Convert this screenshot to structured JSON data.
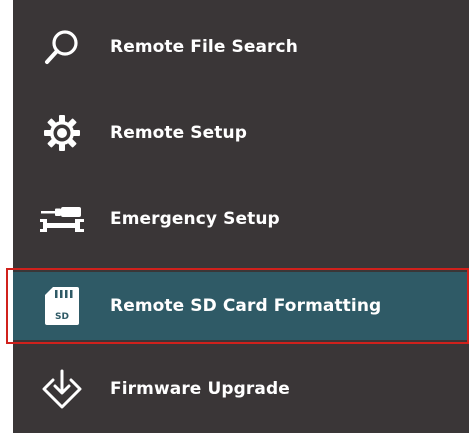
{
  "menu": {
    "items": [
      {
        "label": "Remote File Search",
        "icon": "search-icon",
        "selected": false
      },
      {
        "label": "Remote Setup",
        "icon": "gear-icon",
        "selected": false
      },
      {
        "label": "Emergency Setup",
        "icon": "tools-icon",
        "selected": false
      },
      {
        "label": "Remote SD Card Formatting",
        "icon": "sd-card-icon",
        "icon_text": "SD",
        "selected": true
      },
      {
        "label": "Firmware Upgrade",
        "icon": "download-diamond-icon",
        "selected": false
      }
    ]
  },
  "colors": {
    "menu_background": "#3a3637",
    "selected_background": "#2f5a66",
    "highlight_border": "#d0211c",
    "text": "#ffffff"
  }
}
